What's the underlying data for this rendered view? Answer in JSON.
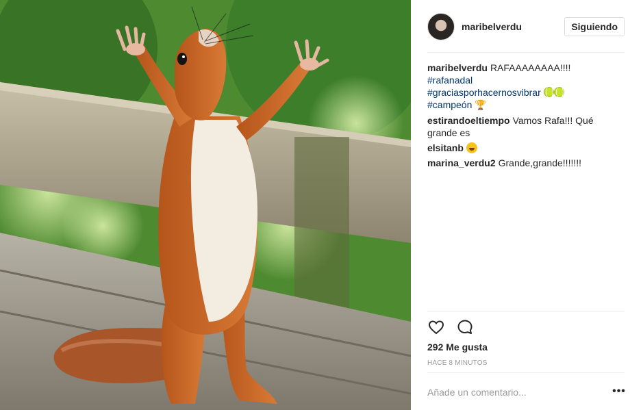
{
  "post": {
    "photo_alt": "squirrel-photo",
    "author": "maribelverdu",
    "follow_label": "Siguiendo",
    "caption": {
      "user": "maribelverdu",
      "text": "RAFAAAAAAAA!!!!",
      "hashtag1": "#rafanadal",
      "hashtag2": "#graciasporhacernosvibrar",
      "hashtag3": "#campeón"
    },
    "comments": [
      {
        "user": "estirandoeltiempo",
        "text": "Vamos Rafa!!! Qué grande es"
      },
      {
        "user": "elsitanb",
        "text": ""
      },
      {
        "user": "marina_verdu2",
        "text": "Grande,grande!!!!!!!"
      }
    ],
    "likes": "292 Me gusta",
    "time": "HACE 8 MINUTOS",
    "comment_placeholder": "Añade un comentario...",
    "more_label": "•••"
  },
  "icons": {
    "like": "heart-icon",
    "comment": "comment-bubble-icon",
    "more": "more-options-icon"
  },
  "colors": {
    "text": "#262626",
    "hashtag": "#003569",
    "muted": "#999999",
    "divider": "#efefef"
  }
}
